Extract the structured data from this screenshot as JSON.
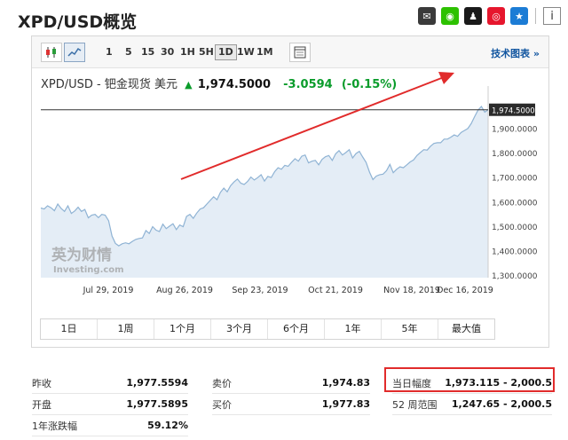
{
  "page": {
    "title": "XPD/USD概览"
  },
  "share": {
    "icons": [
      {
        "name": "email-icon",
        "color": "#3a3a3a",
        "glyph": "✉"
      },
      {
        "name": "wechat-icon",
        "color": "#2dc100",
        "glyph": "◉"
      },
      {
        "name": "qq-icon",
        "color": "#1a1a1a",
        "glyph": "♟"
      },
      {
        "name": "weibo-icon",
        "color": "#e6162d",
        "glyph": "◎"
      },
      {
        "name": "qzone-icon",
        "color": "#1c7cd5",
        "glyph": "★"
      }
    ],
    "info_glyph": "i"
  },
  "toolbar": {
    "periods": [
      "1",
      "5",
      "15",
      "30",
      "1H",
      "5H",
      "1D",
      "1W",
      "1M"
    ],
    "active_period": "1D",
    "tech_chart_label": "技术图表 »"
  },
  "quote": {
    "pair": "XPD/USD - 钯金现货 美元",
    "direction_glyph": "▲",
    "last": "1,974.5000",
    "change": "-3.0594",
    "change_pct": "(-0.15%)"
  },
  "watermark": {
    "cn": "英为财情",
    "en": "Investing",
    "suffix": ".com"
  },
  "chart_data": {
    "type": "area",
    "x_ticks": [
      "Jul 29, 2019",
      "Aug 26, 2019",
      "Sep 23, 2019",
      "Oct 21, 2019",
      "Nov 18, 2019",
      "Dec 16, 2019"
    ],
    "y_ticks": [
      "1,300.0000",
      "1,400.0000",
      "1,500.0000",
      "1,600.0000",
      "1,700.0000",
      "1,800.0000",
      "1,900.0000"
    ],
    "ylim": [
      1290,
      2035
    ],
    "current_label": "1,974.5000",
    "current_value": 1974.5,
    "grid": false,
    "series": [
      {
        "values": [
          1574,
          1570,
          1583,
          1575,
          1563,
          1590,
          1572,
          1560,
          1583,
          1552,
          1562,
          1577,
          1560,
          1568,
          1534,
          1545,
          1548,
          1535,
          1548,
          1545,
          1522,
          1460,
          1430,
          1420,
          1428,
          1432,
          1428,
          1438,
          1446,
          1450,
          1452,
          1482,
          1470,
          1498,
          1484,
          1478,
          1508,
          1490,
          1500,
          1510,
          1486,
          1505,
          1498,
          1540,
          1548,
          1532,
          1553,
          1570,
          1575,
          1590,
          1605,
          1620,
          1608,
          1638,
          1655,
          1640,
          1665,
          1680,
          1692,
          1675,
          1670,
          1682,
          1700,
          1688,
          1698,
          1710,
          1684,
          1703,
          1698,
          1722,
          1738,
          1732,
          1748,
          1744,
          1760,
          1775,
          1765,
          1785,
          1790,
          1758,
          1765,
          1768,
          1750,
          1772,
          1783,
          1788,
          1768,
          1795,
          1808,
          1790,
          1800,
          1812,
          1778,
          1796,
          1805,
          1782,
          1760,
          1720,
          1690,
          1704,
          1710,
          1712,
          1726,
          1752,
          1718,
          1732,
          1742,
          1738,
          1750,
          1762,
          1770,
          1788,
          1800,
          1812,
          1810,
          1826,
          1837,
          1840,
          1840,
          1855,
          1855,
          1863,
          1872,
          1866,
          1882,
          1890,
          1898,
          1918,
          1946,
          1972,
          1988,
          1965,
          1974.5
        ]
      }
    ]
  },
  "range_buttons": [
    "1日",
    "1周",
    "1个月",
    "3个月",
    "6个月",
    "1年",
    "5年",
    "最大值"
  ],
  "stats": {
    "rows": [
      {
        "label": "昨收",
        "value": "1,977.5594"
      },
      {
        "label": "开盘",
        "value": "1,977.5895"
      },
      {
        "label": "1年涨跌幅",
        "value": "59.12%"
      },
      {
        "label": "卖价",
        "value": "1,974.83"
      },
      {
        "label": "买价",
        "value": "1,977.83"
      },
      {
        "label": "当日幅度",
        "value": "1,973.115 - 2,000.5"
      },
      {
        "label": "52 周范围",
        "value": "1,247.65 - 2,000.5"
      }
    ]
  },
  "colors": {
    "line": "#8fb3d4",
    "fill": "#e4edf6",
    "annotation": "#e12b2b",
    "positive": "#0a9c2b",
    "accent": "#1256a0"
  }
}
